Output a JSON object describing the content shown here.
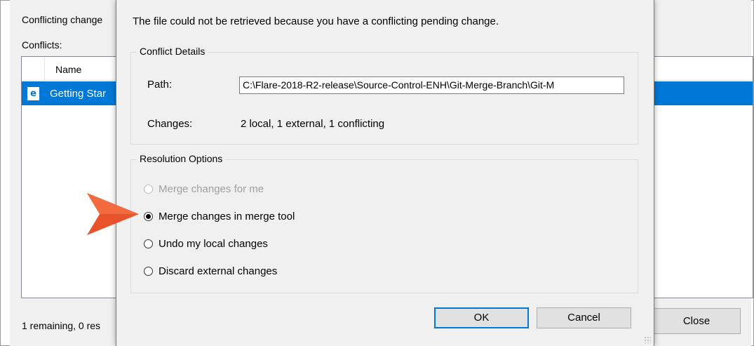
{
  "background_window": {
    "header_text": "Conflicting change",
    "conflicts_label": "Conflicts:",
    "list_column_name": "Name",
    "selected_file": "Getting Star",
    "status_text": "1 remaining, 0 res",
    "close_label": "Close"
  },
  "dialog": {
    "message": "The file could not be retrieved because you have a conflicting pending change.",
    "conflict_details": {
      "title": "Conflict Details",
      "path_label": "Path:",
      "path_value": "C:\\Flare-2018-R2-release\\Source-Control-ENH\\Git-Merge-Branch\\Git-M",
      "changes_label": "Changes:",
      "changes_value": "2 local, 1 external, 1 conflicting"
    },
    "resolution_options": {
      "title": "Resolution Options",
      "options": [
        {
          "label": "Merge changes for me",
          "state": "disabled"
        },
        {
          "label": "Merge changes in merge tool",
          "state": "selected"
        },
        {
          "label": "Undo my local changes",
          "state": "normal"
        },
        {
          "label": "Discard external changes",
          "state": "normal"
        }
      ]
    },
    "ok_label": "OK",
    "cancel_label": "Cancel"
  },
  "colors": {
    "accent": "#0078d7",
    "arrow": "#e8532b"
  },
  "icons": {
    "file": "html-file-icon",
    "pointer": "callout-arrow-icon"
  }
}
